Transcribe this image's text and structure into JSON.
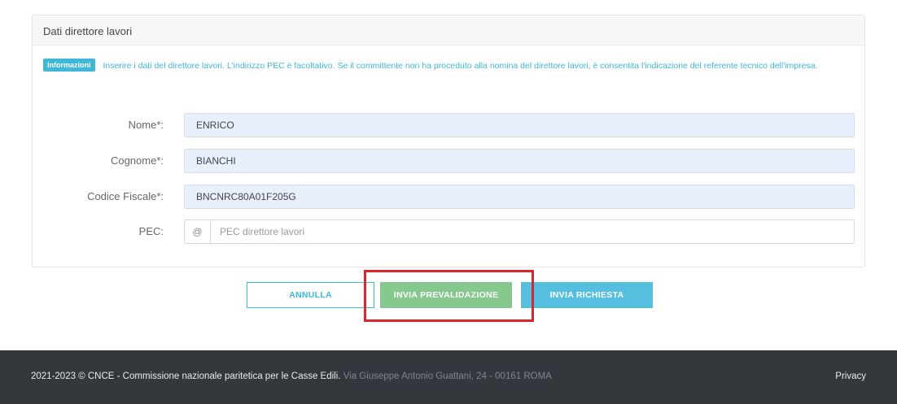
{
  "panel": {
    "title": "Dati direttore lavori",
    "info_badge": "Informazioni",
    "info_text": "Inserire i dati del direttore lavori. L'indirizzo PEC è facoltativo. Se il committente non ha proceduto alla nomina del direttore lavori, è consentita l'indicazione del referente tecnico dell'impresa."
  },
  "form": {
    "nome": {
      "label": "Nome*:",
      "value": "ENRICO"
    },
    "cognome": {
      "label": "Cognome*:",
      "value": "BIANCHI"
    },
    "codice_fiscale": {
      "label": "Codice Fiscale*:",
      "value": "BNCNRC80A01F205G"
    },
    "pec": {
      "label": "PEC:",
      "addon": "@",
      "value": "",
      "placeholder": "PEC direttore lavori"
    }
  },
  "actions": {
    "cancel_label": "ANNULLA",
    "prevalidate_label": "INVIA PREVALIDAZIONE",
    "send_label": "INVIA RICHIESTA"
  },
  "footer": {
    "copyright": "2021-2023 © CNCE - Commissione nazionale paritetica per le Casse Edili.",
    "address": "Via Giuseppe Antonio Guattani, 24 - 00161 ROMA",
    "privacy_label": "Privacy"
  },
  "colors": {
    "accent": "#3fb7d6",
    "prevalidate": "#86c98f",
    "send": "#56bfe0",
    "highlight": "#e0242c",
    "footer_bg": "#33383d"
  }
}
